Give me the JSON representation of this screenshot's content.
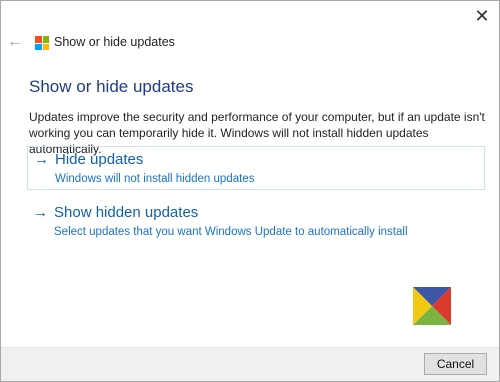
{
  "window": {
    "close_glyph": "✕",
    "back_glyph": "←",
    "title": "Show or hide updates"
  },
  "main": {
    "heading": "Show or hide updates",
    "description": "Updates improve the security and performance of your computer, but if an update isn't working you can temporarily hide it. Windows will not install hidden updates automatically.",
    "options": [
      {
        "arrow": "→",
        "title": "Hide updates",
        "subtitle": "Windows will not install hidden updates"
      },
      {
        "arrow": "→",
        "title": "Show hidden updates",
        "subtitle": "Select updates that you want Windows Update to automatically install"
      }
    ]
  },
  "footer": {
    "cancel_label": "Cancel"
  },
  "colors": {
    "heading": "#1f3c88",
    "link": "#1261ad",
    "win_logo": [
      "#f25022",
      "#7fba00",
      "#00a4ef",
      "#ffb900"
    ],
    "brand_logo": [
      "#3b57a6",
      "#d83a2e",
      "#7cb342",
      "#f2c811"
    ]
  }
}
